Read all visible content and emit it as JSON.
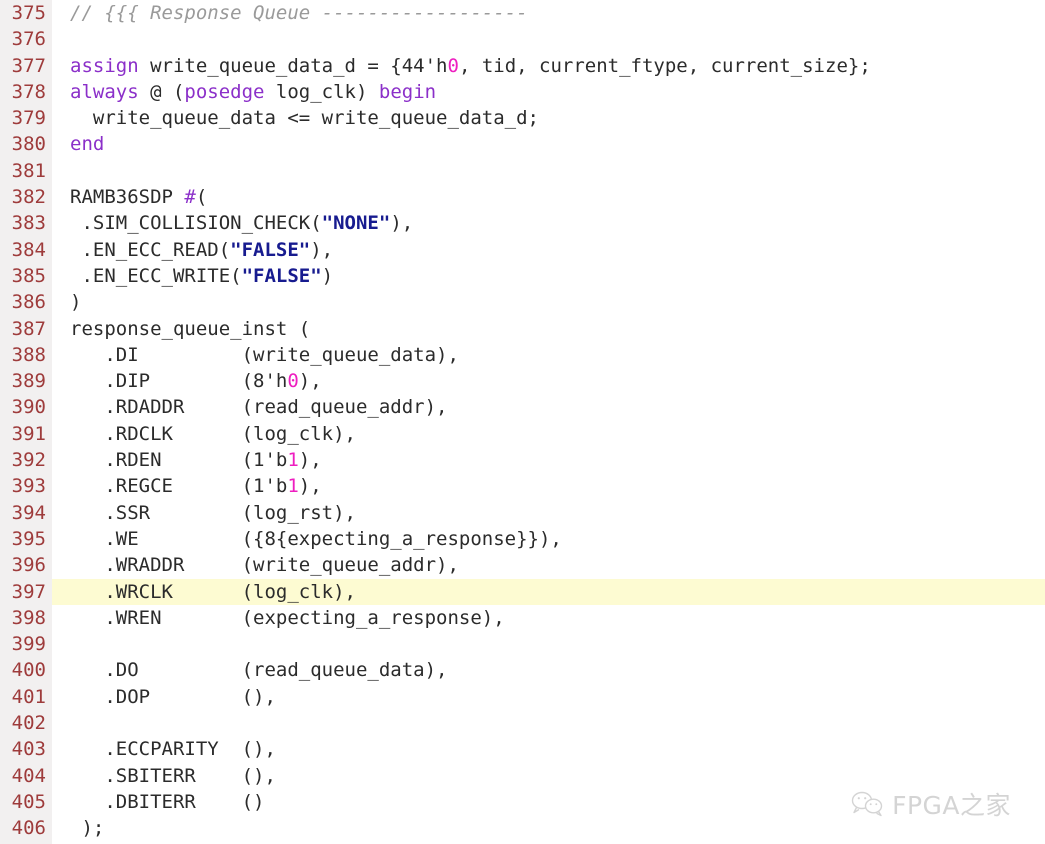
{
  "editor": {
    "language": "verilog",
    "first_line": 375,
    "last_line": 406,
    "highlighted_line": 397,
    "gutter_bg": "#f2f0f0",
    "background": "#ffffff",
    "lineno_color": "#9e3b3b",
    "highlight_color": "#fdfbd2",
    "colors": {
      "plain": "#2b2b2b",
      "comment": "#9a9a9a",
      "keyword": "#8b2fc9",
      "number": "#ee1ec0",
      "string": "#171b8f"
    }
  },
  "lines": [
    {
      "n": "375",
      "tokens": [
        {
          "t": "comment",
          "s": "// {{{ Response Queue ------------------"
        }
      ]
    },
    {
      "n": "376",
      "tokens": []
    },
    {
      "n": "377",
      "tokens": [
        {
          "t": "keyword",
          "s": "assign"
        },
        {
          "t": "plain",
          "s": " write_queue_data_d = {44'h"
        },
        {
          "t": "number",
          "s": "0"
        },
        {
          "t": "plain",
          "s": ", tid, current_ftype, current_size};"
        }
      ]
    },
    {
      "n": "378",
      "tokens": [
        {
          "t": "keyword",
          "s": "always"
        },
        {
          "t": "plain",
          "s": " @ ("
        },
        {
          "t": "keyword",
          "s": "posedge"
        },
        {
          "t": "plain",
          "s": " log_clk) "
        },
        {
          "t": "keyword",
          "s": "begin"
        }
      ]
    },
    {
      "n": "379",
      "tokens": [
        {
          "t": "plain",
          "s": "  write_queue_data <= write_queue_data_d;"
        }
      ]
    },
    {
      "n": "380",
      "tokens": [
        {
          "t": "keyword",
          "s": "end"
        }
      ]
    },
    {
      "n": "381",
      "tokens": []
    },
    {
      "n": "382",
      "tokens": [
        {
          "t": "plain",
          "s": "RAMB36SDP "
        },
        {
          "t": "keyword",
          "s": "#"
        },
        {
          "t": "plain",
          "s": "("
        }
      ]
    },
    {
      "n": "383",
      "tokens": [
        {
          "t": "plain",
          "s": " .SIM_COLLISION_CHECK("
        },
        {
          "t": "string",
          "s": "\"NONE\""
        },
        {
          "t": "plain",
          "s": "),"
        }
      ]
    },
    {
      "n": "384",
      "tokens": [
        {
          "t": "plain",
          "s": " .EN_ECC_READ("
        },
        {
          "t": "string",
          "s": "\"FALSE\""
        },
        {
          "t": "plain",
          "s": "),"
        }
      ]
    },
    {
      "n": "385",
      "tokens": [
        {
          "t": "plain",
          "s": " .EN_ECC_WRITE("
        },
        {
          "t": "string",
          "s": "\"FALSE\""
        },
        {
          "t": "plain",
          "s": ")"
        }
      ]
    },
    {
      "n": "386",
      "tokens": [
        {
          "t": "plain",
          "s": ")"
        }
      ]
    },
    {
      "n": "387",
      "tokens": [
        {
          "t": "plain",
          "s": "response_queue_inst ("
        }
      ]
    },
    {
      "n": "388",
      "tokens": [
        {
          "t": "plain",
          "s": "   .DI         (write_queue_data),"
        }
      ]
    },
    {
      "n": "389",
      "tokens": [
        {
          "t": "plain",
          "s": "   .DIP        (8'h"
        },
        {
          "t": "number",
          "s": "0"
        },
        {
          "t": "plain",
          "s": "),"
        }
      ]
    },
    {
      "n": "390",
      "tokens": [
        {
          "t": "plain",
          "s": "   .RDADDR     (read_queue_addr),"
        }
      ]
    },
    {
      "n": "391",
      "tokens": [
        {
          "t": "plain",
          "s": "   .RDCLK      (log_clk),"
        }
      ]
    },
    {
      "n": "392",
      "tokens": [
        {
          "t": "plain",
          "s": "   .RDEN       (1'b"
        },
        {
          "t": "number",
          "s": "1"
        },
        {
          "t": "plain",
          "s": "),"
        }
      ]
    },
    {
      "n": "393",
      "tokens": [
        {
          "t": "plain",
          "s": "   .REGCE      (1'b"
        },
        {
          "t": "number",
          "s": "1"
        },
        {
          "t": "plain",
          "s": "),"
        }
      ]
    },
    {
      "n": "394",
      "tokens": [
        {
          "t": "plain",
          "s": "   .SSR        (log_rst),"
        }
      ]
    },
    {
      "n": "395",
      "tokens": [
        {
          "t": "plain",
          "s": "   .WE         ({8{expecting_a_response}}),"
        }
      ]
    },
    {
      "n": "396",
      "tokens": [
        {
          "t": "plain",
          "s": "   .WRADDR     (write_queue_addr),"
        }
      ]
    },
    {
      "n": "397",
      "tokens": [
        {
          "t": "plain",
          "s": "   .WRCLK      (log_clk),"
        }
      ],
      "highlight": true
    },
    {
      "n": "398",
      "tokens": [
        {
          "t": "plain",
          "s": "   .WREN       (expecting_a_response),"
        }
      ]
    },
    {
      "n": "399",
      "tokens": []
    },
    {
      "n": "400",
      "tokens": [
        {
          "t": "plain",
          "s": "   .DO         (read_queue_data),"
        }
      ]
    },
    {
      "n": "401",
      "tokens": [
        {
          "t": "plain",
          "s": "   .DOP        (),"
        }
      ]
    },
    {
      "n": "402",
      "tokens": []
    },
    {
      "n": "403",
      "tokens": [
        {
          "t": "plain",
          "s": "   .ECCPARITY  (),"
        }
      ]
    },
    {
      "n": "404",
      "tokens": [
        {
          "t": "plain",
          "s": "   .SBITERR    (),"
        }
      ]
    },
    {
      "n": "405",
      "tokens": [
        {
          "t": "plain",
          "s": "   .DBITERR    ()"
        }
      ]
    },
    {
      "n": "406",
      "tokens": [
        {
          "t": "plain",
          "s": " );"
        }
      ]
    }
  ],
  "watermark": {
    "text": "FPGA之家",
    "icon": "wechat-icon"
  }
}
